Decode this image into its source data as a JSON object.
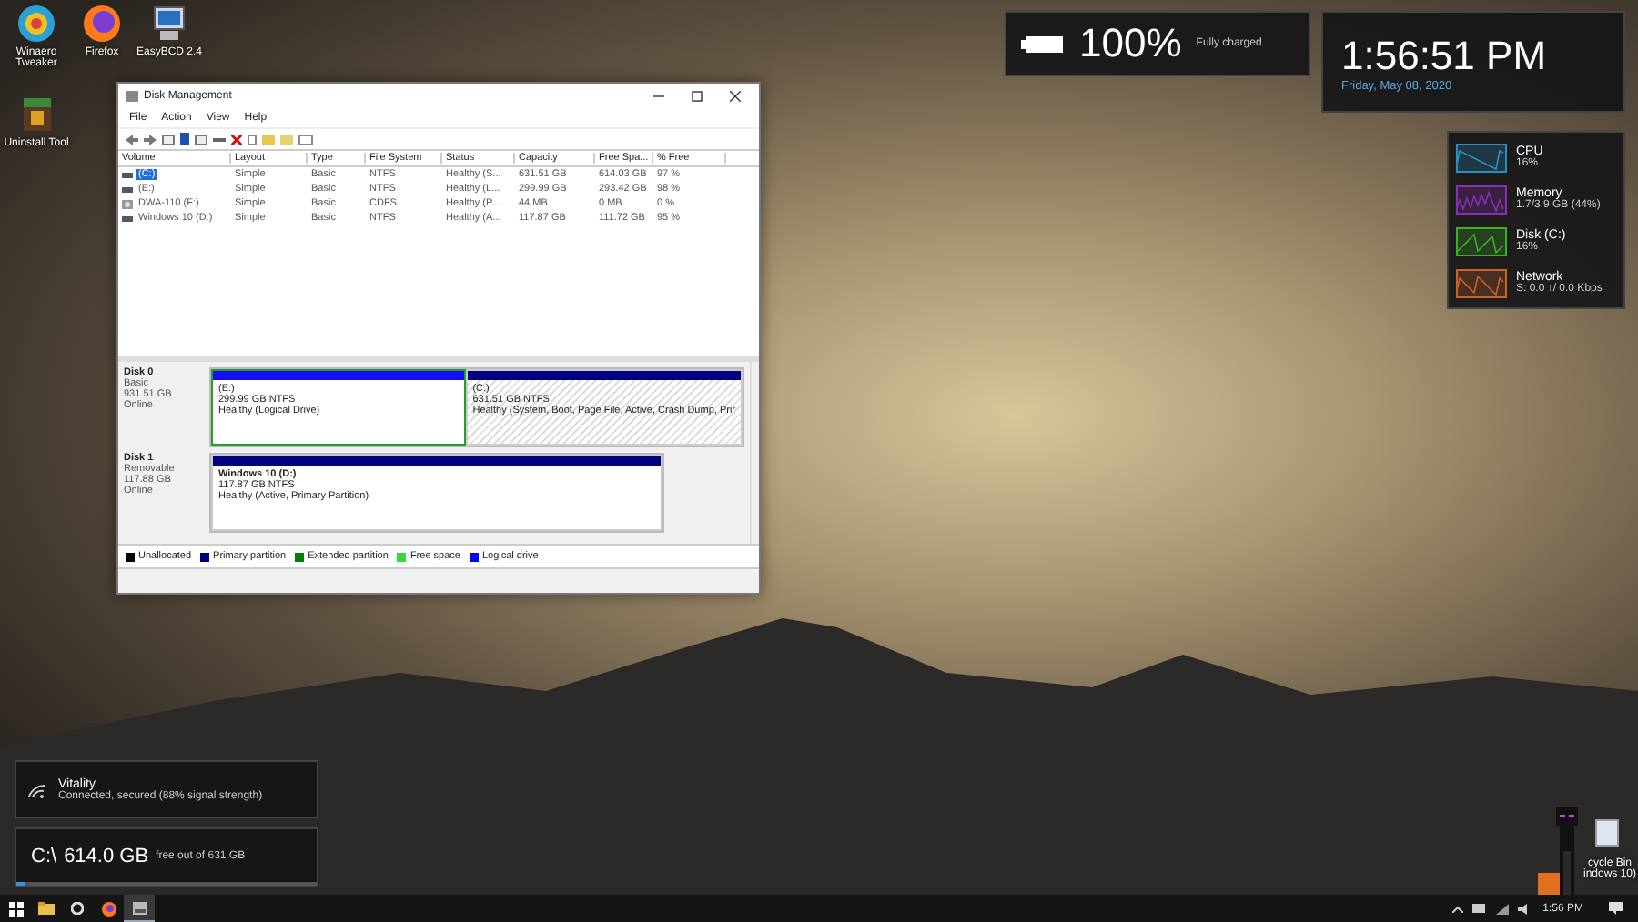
{
  "desktop_icons": [
    {
      "kind": "winaero",
      "label": "Winaero Tweaker"
    },
    {
      "kind": "firefox",
      "label": "Firefox"
    },
    {
      "kind": "easybcd",
      "label": "EasyBCD 2.4"
    },
    {
      "kind": "uninstall",
      "label": "Uninstall Tool"
    }
  ],
  "window": {
    "title": "Disk Management",
    "menu": [
      "File",
      "Action",
      "View",
      "Help"
    ],
    "columns": [
      "Volume",
      "Layout",
      "Type",
      "File System",
      "Status",
      "Capacity",
      "Free Spa...",
      "% Free"
    ],
    "rows": [
      {
        "kind": "drive",
        "selected": true,
        "cells": [
          "(C:)",
          "Simple",
          "Basic",
          "NTFS",
          "Healthy (S...",
          "631.51 GB",
          "614.03 GB",
          "97 %"
        ]
      },
      {
        "kind": "drive",
        "selected": false,
        "cells": [
          "(E:)",
          "Simple",
          "Basic",
          "NTFS",
          "Healthy (L...",
          "299.99 GB",
          "293.42 GB",
          "98 %"
        ]
      },
      {
        "kind": "cd",
        "selected": false,
        "cells": [
          "DWA-110 (F:)",
          "Simple",
          "Basic",
          "CDFS",
          "Healthy (P...",
          "44 MB",
          "0 MB",
          "0 %"
        ]
      },
      {
        "kind": "drive",
        "selected": false,
        "cells": [
          "Windows 10 (D:)",
          "Simple",
          "Basic",
          "NTFS",
          "Healthy (A...",
          "117.87 GB",
          "111.72 GB",
          "95 %"
        ]
      }
    ],
    "disks": [
      {
        "name": "Disk 0",
        "type": "Basic",
        "size": "931.51 GB",
        "status": "Online",
        "partitions": [
          {
            "kind": "logical",
            "selected": false,
            "label": "(E:)",
            "size": "299.99 GB NTFS",
            "status": "Healthy (Logical Drive)"
          },
          {
            "kind": "primary",
            "selected": true,
            "label": "(C:)",
            "size": "631.51 GB NTFS",
            "status": "Healthy (System, Boot, Page File, Active, Crash Dump, Prir"
          }
        ]
      },
      {
        "name": "Disk 1",
        "type": "Removable",
        "size": "117.88 GB",
        "status": "Online",
        "partitions": [
          {
            "kind": "primary",
            "selected": false,
            "label": "Windows 10  (D:)",
            "size": "117.87 GB NTFS",
            "status": "Healthy (Active, Primary Partition)"
          }
        ]
      }
    ],
    "legend": [
      {
        "label": "Unallocated",
        "color": "#000000"
      },
      {
        "label": "Primary partition",
        "color": "#000080"
      },
      {
        "label": "Extended partition",
        "color": "#008000"
      },
      {
        "label": "Free space",
        "color": "#33dd33"
      },
      {
        "label": "Logical drive",
        "color": "#0000ff"
      }
    ]
  },
  "battery": {
    "percent": "100%",
    "status": "Fully charged"
  },
  "clock": {
    "time": "1:56:51 PM",
    "date": "Friday, May 08, 2020"
  },
  "monitors": [
    {
      "name": "CPU",
      "reading": "16%",
      "color": "#2a8fc0"
    },
    {
      "name": "Memory",
      "reading": "1.7/3.9 GB (44%)",
      "color": "#8a2fb0"
    },
    {
      "name": "Disk (C:)",
      "reading": "16%",
      "color": "#3fae2a"
    },
    {
      "name": "Network",
      "reading": "S: 0.0 ↑/ 0.0 Kbps",
      "color": "#c8642a"
    }
  ],
  "wifi": {
    "name": "Vitality",
    "status": "Connected, secured (88% signal strength)"
  },
  "drive": {
    "path": "C:\\",
    "free": "614.0 GB",
    "detail": "free out of 631 GB",
    "level": 0.03
  },
  "recycle_bin": [
    "cycle Bin",
    "indows 10)"
  ],
  "taskbar": {
    "apps": [
      {
        "kind": "explorer",
        "selected": false
      },
      {
        "kind": "settings",
        "selected": false
      },
      {
        "kind": "firefox",
        "selected": false
      },
      {
        "kind": "diskmgmt",
        "selected": true
      }
    ],
    "time": "1:56 PM"
  }
}
